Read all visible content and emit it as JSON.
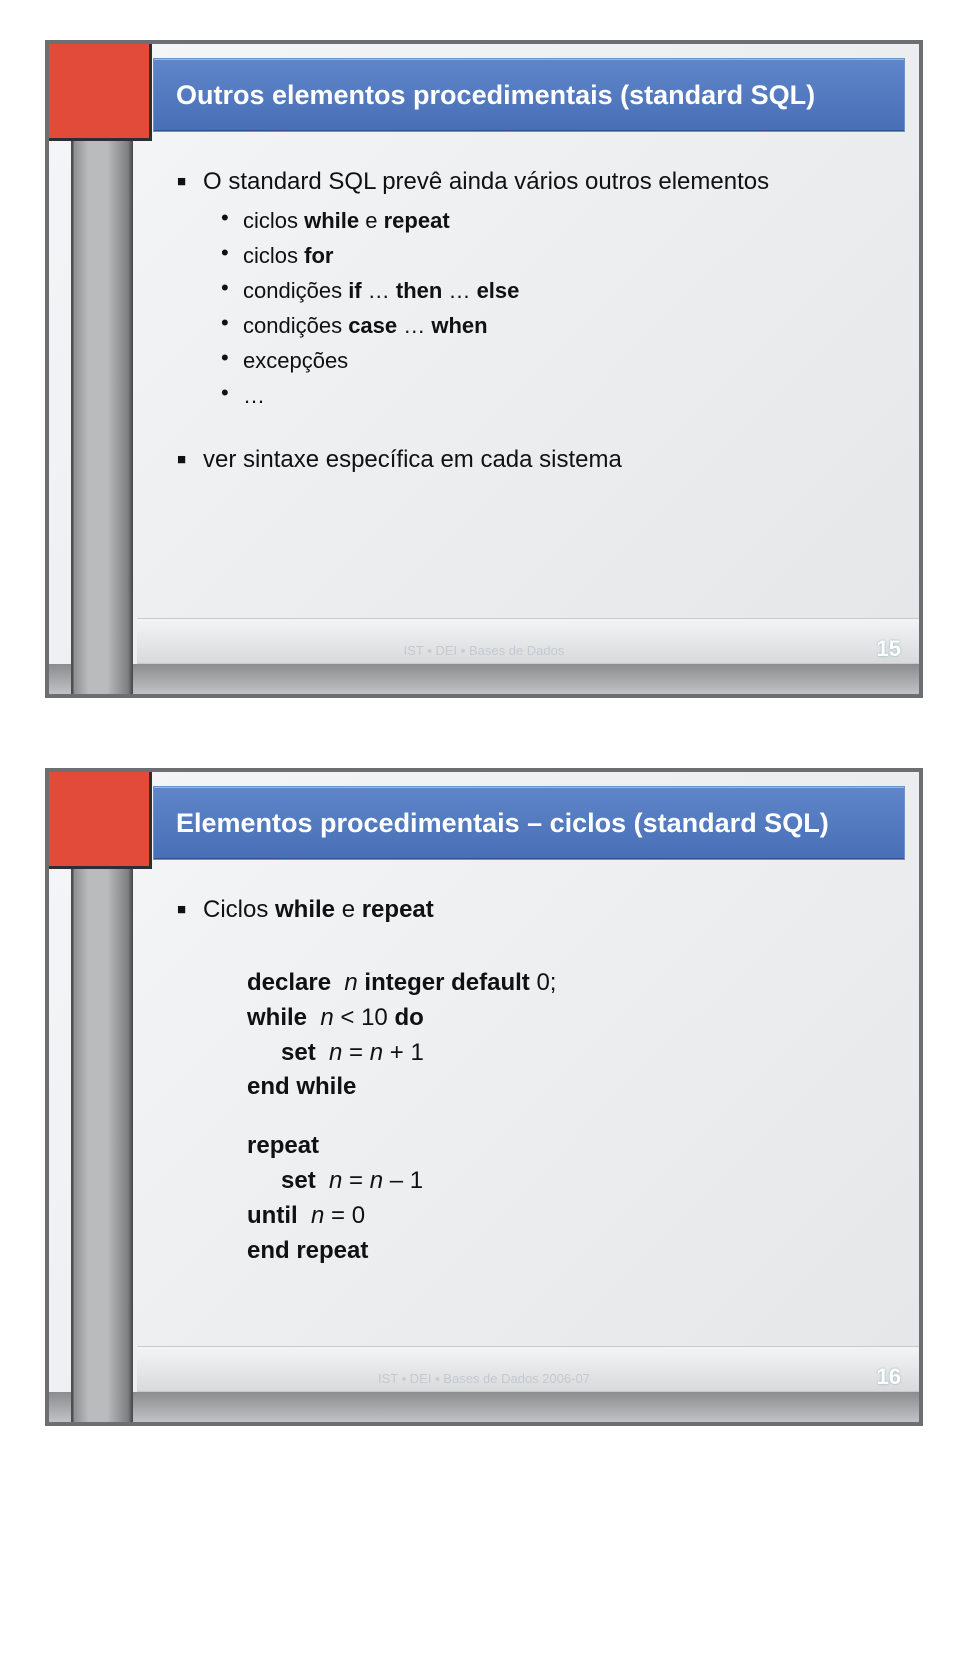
{
  "slide1": {
    "title": "Outros elementos procedimentais (standard SQL)",
    "b1_1": "O standard SQL prevê ainda vários outros elementos",
    "b2_1_pre": "ciclos ",
    "b2_1_b1": "while",
    "b2_1_mid": " e ",
    "b2_1_b2": "repeat",
    "b2_2_pre": "ciclos ",
    "b2_2_b1": "for",
    "b2_3_pre": "condições ",
    "b2_3_b1": "if",
    "b2_3_mid1": " … ",
    "b2_3_b2": "then",
    "b2_3_mid2": " … ",
    "b2_3_b3": "else",
    "b2_4_pre": "condições ",
    "b2_4_b1": "case",
    "b2_4_mid": " … ",
    "b2_4_b2": "when",
    "b2_5": "excepções",
    "b2_6": "…",
    "b1_2": "ver sintaxe específica em cada sistema",
    "footer": "IST ▪ DEI ▪ Bases de Dados",
    "pagenum": "15"
  },
  "slide2": {
    "title": "Elementos procedimentais – ciclos (standard SQL)",
    "b1_1_pre": "Ciclos ",
    "b1_1_b1": "while",
    "b1_1_mid": " e ",
    "b1_1_b2": "repeat",
    "c_declare": "declare",
    "c_n": "n",
    "c_int_def": " integer default ",
    "c_zero": "0;",
    "c_while": "while",
    "c_lt10": " < 10 ",
    "c_do": "do",
    "c_set": "set",
    "c_eq": " = ",
    "c_plus1": " + 1",
    "c_endwhile": "end while",
    "c_repeat": "repeat",
    "c_minus1": " – 1",
    "c_until": "until",
    "c_eq0": " = 0",
    "c_endrepeat": "end repeat",
    "footer": "IST ▪ DEI ▪ Bases de Dados 2006-07",
    "pagenum": "16"
  }
}
